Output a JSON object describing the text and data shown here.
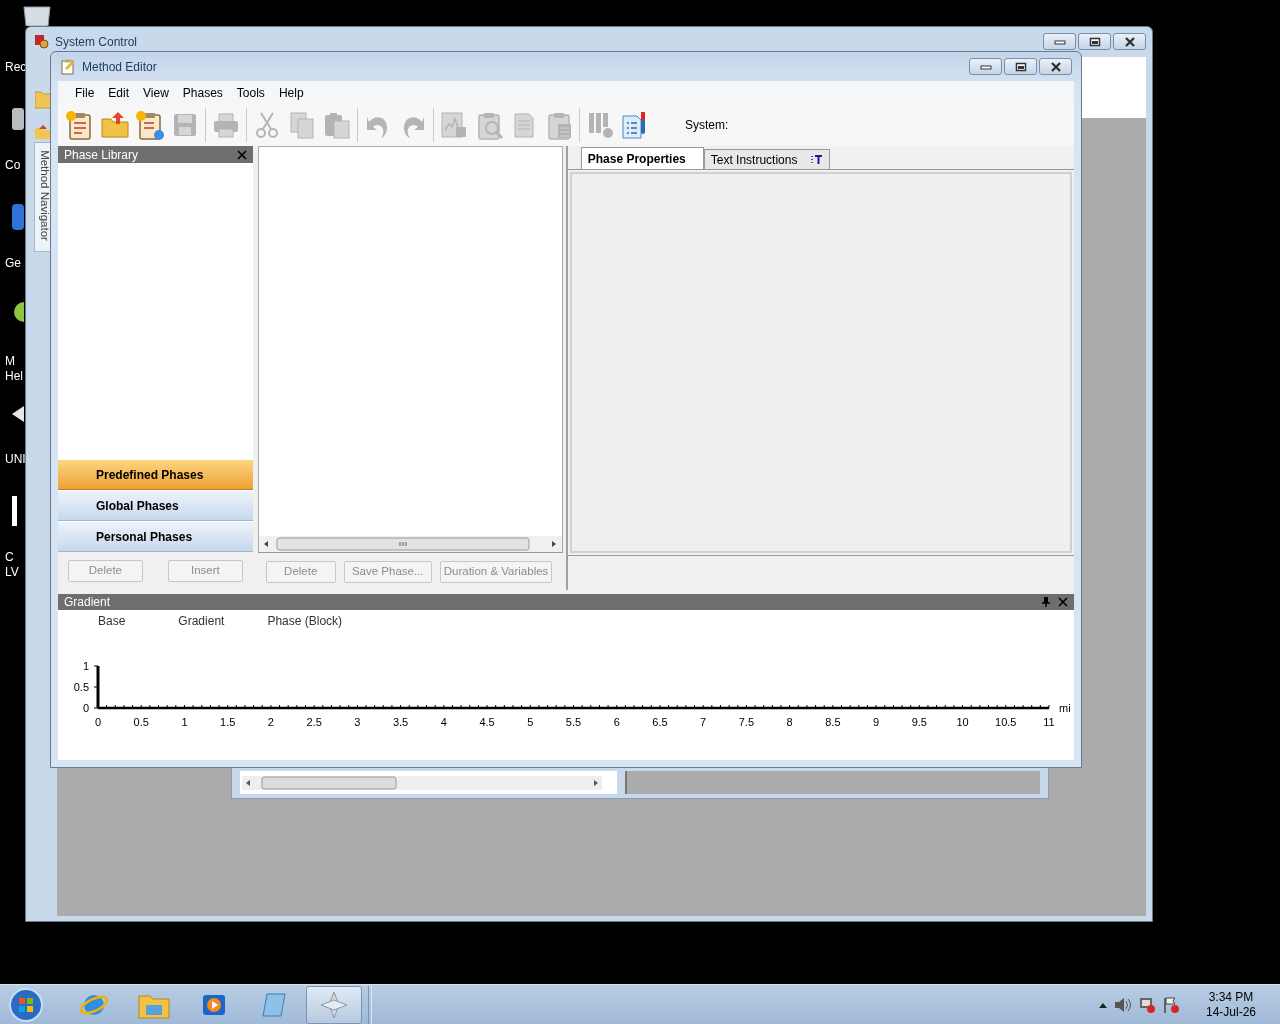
{
  "desktop": {
    "icons": [
      {
        "kind": "bin",
        "lines": [
          "Rec"
        ]
      },
      {
        "kind": "drive",
        "lines": [
          "Co"
        ]
      },
      {
        "kind": "globe",
        "lines": [
          "Ge"
        ]
      },
      {
        "kind": "help",
        "lines": [
          "M",
          "Hel"
        ]
      },
      {
        "kind": "arrow",
        "lines": [
          "UNI"
        ]
      },
      {
        "kind": "page",
        "lines": [
          "C",
          "LV"
        ]
      }
    ]
  },
  "system_control": {
    "title": "System Control",
    "navigator_tab": "Method Navigator"
  },
  "method_editor": {
    "title": "Method Editor",
    "menu": [
      "File",
      "Edit",
      "View",
      "Phases",
      "Tools",
      "Help"
    ],
    "toolbar": [
      [
        {
          "kind": "new",
          "disabled": false
        },
        {
          "kind": "open",
          "disabled": false
        },
        {
          "kind": "import",
          "disabled": false
        },
        {
          "kind": "save",
          "disabled": true
        }
      ],
      [
        {
          "kind": "print",
          "disabled": true
        }
      ],
      [
        {
          "kind": "cut",
          "disabled": true
        },
        {
          "kind": "copy",
          "disabled": true
        },
        {
          "kind": "paste",
          "disabled": true
        }
      ],
      [
        {
          "kind": "undo",
          "disabled": true
        },
        {
          "kind": "redo",
          "disabled": true
        }
      ],
      [
        {
          "kind": "chart",
          "disabled": true
        },
        {
          "kind": "inspect",
          "disabled": true
        },
        {
          "kind": "document",
          "disabled": true
        },
        {
          "kind": "calculator",
          "disabled": true
        }
      ],
      [
        {
          "kind": "tubes",
          "disabled": true
        },
        {
          "kind": "report",
          "disabled": false
        }
      ]
    ],
    "system_label": "System:",
    "phase_library": {
      "title": "Phase Library",
      "groups": [
        {
          "label": "Predefined Phases",
          "selected": true
        },
        {
          "label": "Global Phases",
          "selected": false
        },
        {
          "label": "Personal Phases",
          "selected": false
        }
      ],
      "buttons": [
        {
          "label": "Delete",
          "disabled": true
        },
        {
          "label": "Insert",
          "disabled": true
        }
      ]
    },
    "phase_list": {
      "buttons": [
        {
          "label": "Delete",
          "disabled": true
        },
        {
          "label": "Save Phase...",
          "disabled": true
        },
        {
          "label": "Duration & Variables",
          "disabled": true
        }
      ]
    },
    "tabs": [
      {
        "label": "Phase Properties",
        "selected": true
      },
      {
        "label": "Text Instructions",
        "selected": false
      }
    ],
    "gradient": {
      "title": "Gradient",
      "legend": [
        "Base",
        "Gradient",
        "Phase (Block)"
      ],
      "chart_data": {
        "type": "line",
        "xlabel": "mi",
        "xlim": [
          0,
          11
        ],
        "ylim": [
          0,
          1
        ],
        "xticks": [
          0,
          0.5,
          1,
          1.5,
          2,
          2.5,
          3,
          3.5,
          4,
          4.5,
          5,
          5.5,
          6,
          6.5,
          7,
          7.5,
          8,
          8.5,
          9,
          9.5,
          10,
          10.5,
          11
        ],
        "yticks": [
          0,
          0.5,
          1
        ]
      }
    }
  },
  "taskbar": {
    "apps": [
      {
        "kind": "ie",
        "selected": false
      },
      {
        "kind": "explorer",
        "selected": false
      },
      {
        "kind": "media",
        "selected": false
      },
      {
        "kind": "notepad",
        "selected": false
      },
      {
        "kind": "app",
        "selected": true
      }
    ],
    "time": "3:34 PM",
    "date": "14-Jul-26"
  }
}
